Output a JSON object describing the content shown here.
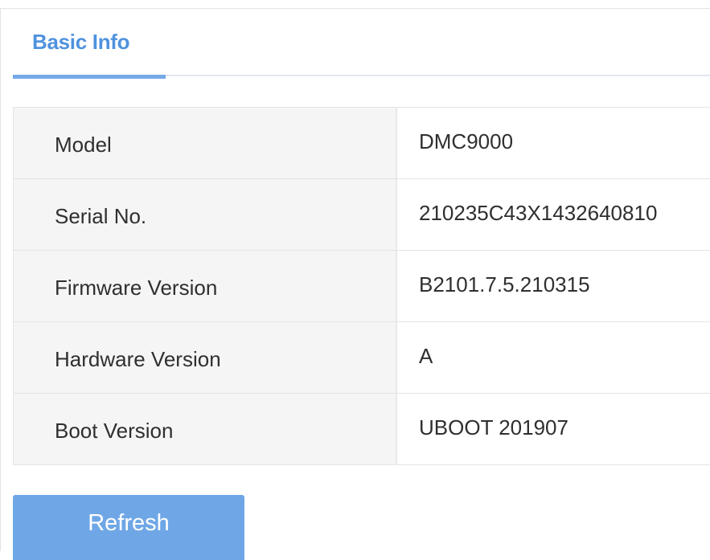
{
  "tabs": [
    {
      "label": "Basic Info",
      "active": true
    }
  ],
  "info": {
    "rows": [
      {
        "label": "Model",
        "value": "DMC9000"
      },
      {
        "label": "Serial No.",
        "value": "210235C43X1432640810"
      },
      {
        "label": "Firmware Version",
        "value": "B2101.7.5.210315"
      },
      {
        "label": "Hardware Version",
        "value": "A"
      },
      {
        "label": "Boot Version",
        "value": "UBOOT 201907"
      }
    ]
  },
  "actions": {
    "refresh_label": "Refresh"
  },
  "colors": {
    "accent": "#4f92de",
    "tab_underline": "#75a9e8",
    "button_bg": "#6fa7e6",
    "label_cell_bg": "#f5f5f5"
  }
}
